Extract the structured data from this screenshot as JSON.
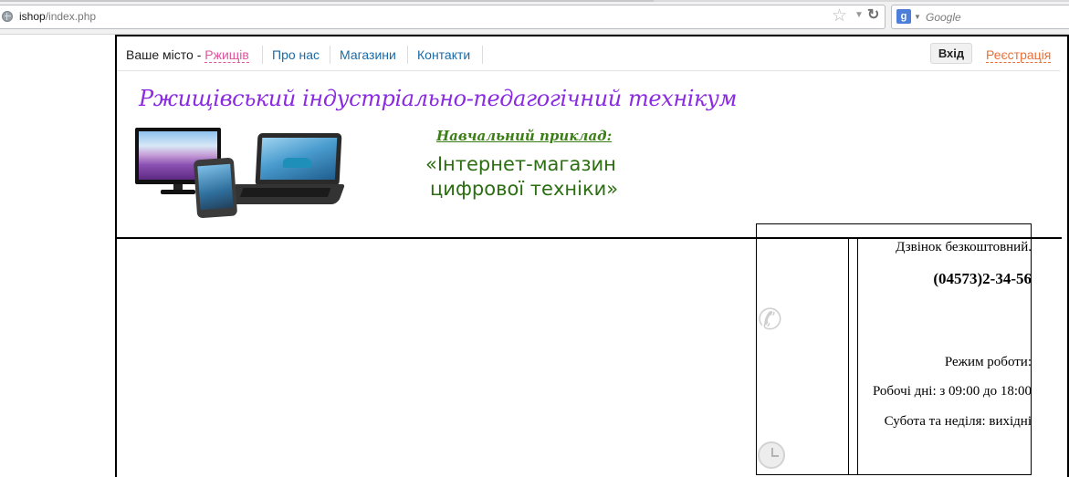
{
  "browser": {
    "url_host": "ishop",
    "url_path": "/index.php",
    "search_placeholder": "Google",
    "search_engine_glyph": "g"
  },
  "topnav": {
    "city_prefix": "Ваше місто - ",
    "city_name": "Ржищів",
    "links": [
      "Про нас",
      "Магазини",
      "Контакти"
    ],
    "login_label": "Вхід",
    "register_label": "Реєстрація"
  },
  "banner": {
    "title": "Ржищівський індустріально-педагогічний технікум",
    "subtitle": "Навчальний приклад:",
    "line1": "«Інтернет-магазин",
    "line2": "цифрової техніки»"
  },
  "contact": {
    "free_call": "Дзвінок безкоштовний.",
    "phone": "(04573)2-34-56",
    "hours_title": "Режим роботи:",
    "weekdays": "Робочі дні: з 09:00 до 18:00",
    "weekend": "Субота та неділя: вихідні"
  },
  "colors": {
    "accent_link": "#1a6aa6",
    "city_link": "#e0559c",
    "register_link": "#e8703a",
    "title_purple": "#8a2be2",
    "subtitle_green": "#3c7f16"
  },
  "icons": [
    "globe-icon",
    "star-icon",
    "reload-icon",
    "phone-icon",
    "clock-icon"
  ]
}
